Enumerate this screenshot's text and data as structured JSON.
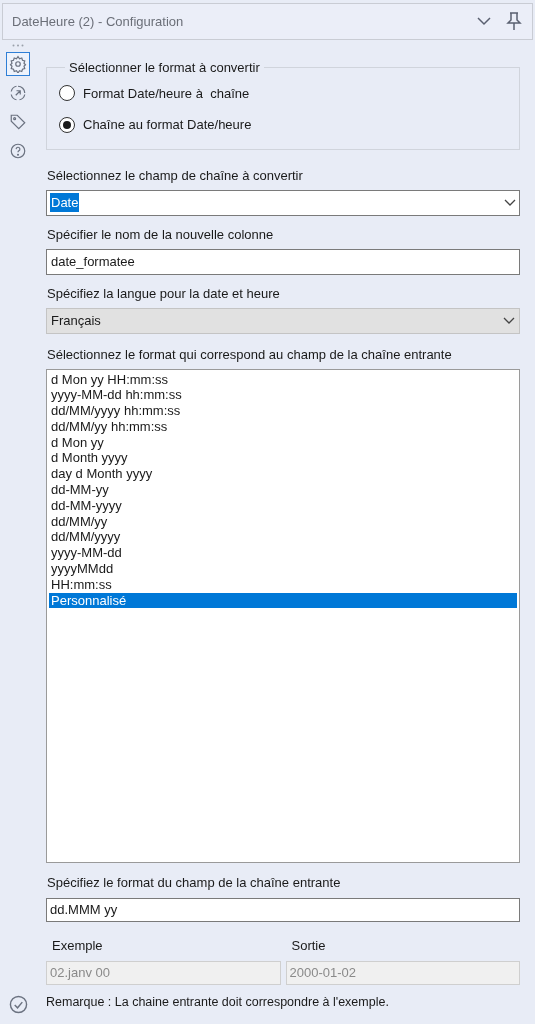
{
  "header": {
    "title": "DateHeure (2) - Configuration"
  },
  "sidebar": {
    "items": [
      {
        "kind": "gear",
        "selected": true
      },
      {
        "kind": "arrow",
        "selected": false
      },
      {
        "kind": "tag",
        "selected": false
      },
      {
        "kind": "help",
        "selected": false
      }
    ]
  },
  "format_group": {
    "legend": "Sélectionner le format à convertir",
    "options": [
      {
        "label": "Format Date/heure à  chaîne",
        "selected": false
      },
      {
        "label": "Chaîne au format Date/heure",
        "selected": true
      }
    ]
  },
  "string_field": {
    "label": "Sélectionnez le champ de chaîne à convertir",
    "value": "Date",
    "text_selected": true
  },
  "new_column": {
    "label": "Spécifier le nom de la nouvelle colonne",
    "value": "date_formatee"
  },
  "language": {
    "label": "Spécifiez la langue pour la date et heure",
    "value": "Français",
    "disabled": true
  },
  "format_list": {
    "label": "Sélectionnez le format qui correspond au champ de la chaîne entrante",
    "items": [
      {
        "label": "d Mon yy HH:mm:ss",
        "selected": false
      },
      {
        "label": "yyyy-MM-dd hh:mm:ss",
        "selected": false
      },
      {
        "label": "dd/MM/yyyy hh:mm:ss",
        "selected": false
      },
      {
        "label": "dd/MM/yy hh:mm:ss",
        "selected": false
      },
      {
        "label": "d Mon yy",
        "selected": false
      },
      {
        "label": "d Month yyyy",
        "selected": false
      },
      {
        "label": "day d Month yyyy",
        "selected": false
      },
      {
        "label": "dd-MM-yy",
        "selected": false
      },
      {
        "label": "dd-MM-yyyy",
        "selected": false
      },
      {
        "label": "dd/MM/yy",
        "selected": false
      },
      {
        "label": "dd/MM/yyyy",
        "selected": false
      },
      {
        "label": "yyyy-MM-dd",
        "selected": false
      },
      {
        "label": "yyyyMMdd",
        "selected": false
      },
      {
        "label": "HH:mm:ss",
        "selected": false
      },
      {
        "label": "Personnalisé",
        "selected": true
      }
    ]
  },
  "custom_format": {
    "label": "Spécifiez le format du champ de la chaîne entrante",
    "value": "dd.MMM yy"
  },
  "example": {
    "label": "Exemple",
    "value": "02.janv 00",
    "disabled": true
  },
  "output": {
    "label": "Sortie",
    "value": "2000-01-02",
    "disabled": true
  },
  "remark": "Remarque : La chaine entrante doit correspondre à l'exemple."
}
